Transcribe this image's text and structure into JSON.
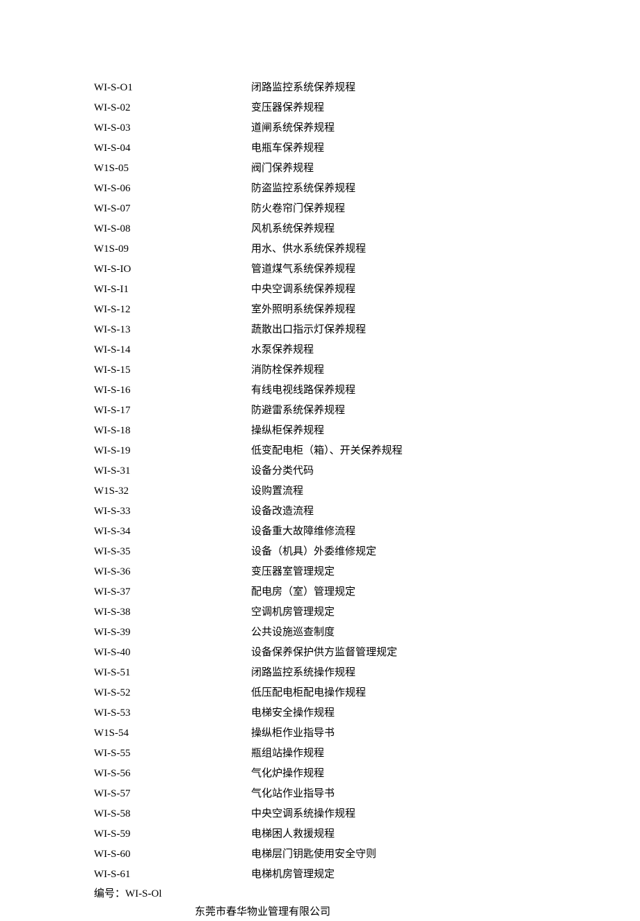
{
  "rows": [
    {
      "code": "WI-S-O1",
      "title": "闭路监控系统保养规程"
    },
    {
      "code": "WI-S-02",
      "title": "变压器保养规程"
    },
    {
      "code": "WI-S-03",
      "title": "道闸系统保养规程"
    },
    {
      "code": "WI-S-04",
      "title": "电瓶车保养规程"
    },
    {
      "code": "W1S-05",
      "title": "阀门保养规程"
    },
    {
      "code": "WI-S-06",
      "title": "防盗监控系统保养规程"
    },
    {
      "code": "WI-S-07",
      "title": "防火卷帘门保养规程"
    },
    {
      "code": "WI-S-08",
      "title": "风机系统保养规程"
    },
    {
      "code": "W1S-09",
      "title": "用水、供水系统保养规程"
    },
    {
      "code": "WI-S-IO",
      "title": "管道煤气系统保养规程"
    },
    {
      "code": "WI-S-I1",
      "title": "中央空调系统保养规程"
    },
    {
      "code": "WI-S-12",
      "title": "室外照明系统保养规程"
    },
    {
      "code": "WI-S-13",
      "title": "蔬散出口指示灯保养规程"
    },
    {
      "code": "WI-S-14",
      "title": "水泵保养规程"
    },
    {
      "code": "WI-S-15",
      "title": "消防栓保养规程"
    },
    {
      "code": "WI-S-16",
      "title": "有线电视线路保养规程"
    },
    {
      "code": "WI-S-17",
      "title": "防避雷系统保养规程"
    },
    {
      "code": "WI-S-18",
      "title": "操纵柜保养规程"
    },
    {
      "code": "WI-S-19",
      "title": "低变配电柜（箱）、开关保养规程"
    },
    {
      "code": "WI-S-31",
      "title": "设备分类代码"
    },
    {
      "code": "W1S-32",
      "title": "设购置流程"
    },
    {
      "code": "WI-S-33",
      "title": "设备改造流程"
    },
    {
      "code": "WI-S-34",
      "title": "设备重大故障维修流程"
    },
    {
      "code": "WI-S-35",
      "title": "设备（机具）外委维修规定"
    },
    {
      "code": "WI-S-36",
      "title": "变压器室管理规定"
    },
    {
      "code": "WI-S-37",
      "title": "配电房（室）管理规定"
    },
    {
      "code": "WI-S-38",
      "title": "空调机房管理规定"
    },
    {
      "code": "WI-S-39",
      "title": "公共设施巡查制度"
    },
    {
      "code": "WI-S-40",
      "title": "设备保养保护供方监督管理规定"
    },
    {
      "code": "WI-S-51",
      "title": "闭路监控系统操作规程"
    },
    {
      "code": "WI-S-52",
      "title": "低压配电柜配电操作规程"
    },
    {
      "code": "WI-S-53",
      "title": "电梯安全操作规程"
    },
    {
      "code": "W1S-54",
      "title": "操纵柜作业指导书"
    },
    {
      "code": "WI-S-55",
      "title": "瓶组站操作规程"
    },
    {
      "code": "WI-S-56",
      "title": "气化炉操作规程"
    },
    {
      "code": "WI-S-57",
      "title": "气化站作业指导书"
    },
    {
      "code": "WI-S-58",
      "title": "中央空调系统操作规程"
    },
    {
      "code": "WI-S-59",
      "title": "电梯困人救援规程"
    },
    {
      "code": "WI-S-60",
      "title": "电梯层门钥匙使用安全守则"
    },
    {
      "code": "WI-S-61",
      "title": "电梯机房管理规定"
    }
  ],
  "footer": {
    "numbering": "编号：WI-S-Ol",
    "company": "东莞市春华物业管理有限公司"
  }
}
